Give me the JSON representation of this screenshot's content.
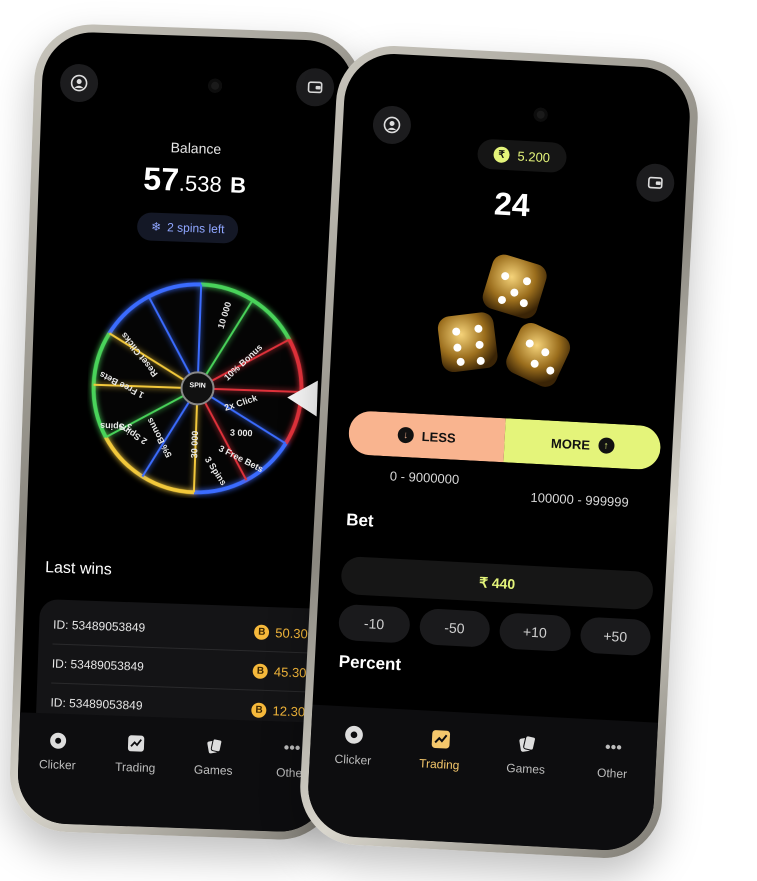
{
  "left": {
    "balance_label": "Balance",
    "balance_int": "57",
    "balance_dec": ".538",
    "balance_unit": "B",
    "spins_left": "2 spins left",
    "wheel_center": "SPIN",
    "wheel_segments": [
      "10 000",
      "10% Bonus",
      "2x Click",
      "3 000",
      "3 Free Bets",
      "3 Spins",
      "30 000",
      "5% Bonus",
      "2 Spins",
      "3 Spins",
      "1 Free Bets",
      "Reset Clicks"
    ],
    "last_wins_title": "Last wins",
    "wins": [
      {
        "id": "ID: 53489053849",
        "amount": "50.300"
      },
      {
        "id": "ID: 53489053849",
        "amount": "45.300"
      },
      {
        "id": "ID: 53489053849",
        "amount": "12.300"
      }
    ],
    "coin_symbol": "B",
    "nav": [
      "Clicker",
      "Trading",
      "Games",
      "Other"
    ]
  },
  "right": {
    "balance_chip": "5.200",
    "currency_symbol": "₹",
    "result_number": "24",
    "less_label": "LESS",
    "more_label": "MORE",
    "less_range": "0 - 9000000",
    "more_range": "100000 - 999999",
    "bet_title": "Bet",
    "bet_value": "₹ 440",
    "adjust_buttons": [
      "-10",
      "-50",
      "+10",
      "+50"
    ],
    "percent_title": "Percent",
    "nav": [
      "Clicker",
      "Trading",
      "Games",
      "Other"
    ],
    "active_nav": "Trading"
  },
  "colors": {
    "less": "#f9b48f",
    "more": "#e4f47a",
    "gold": "#f6b93b",
    "active_nav": "#f4c76b"
  }
}
